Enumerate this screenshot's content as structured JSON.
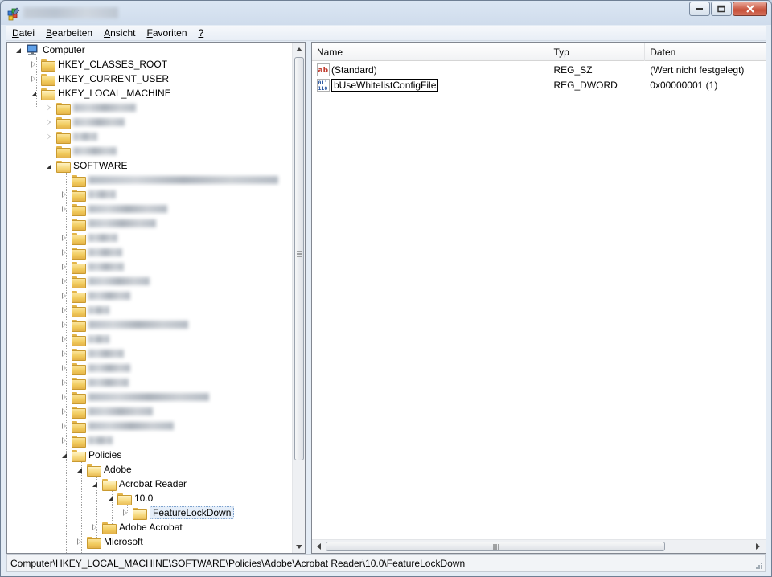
{
  "menu": [
    {
      "label": "Datei",
      "accel": "D",
      "rest": "atei"
    },
    {
      "label": "Bearbeiten",
      "accel": "B",
      "rest": "earbeiten"
    },
    {
      "label": "Ansicht",
      "accel": "A",
      "rest": "nsicht"
    },
    {
      "label": "Favoriten",
      "accel": "F",
      "rest": "avoriten"
    },
    {
      "label": "?",
      "accel": "?",
      "rest": ""
    }
  ],
  "tree": {
    "computer": "Computer",
    "hkcr": "HKEY_CLASSES_ROOT",
    "hkcu": "HKEY_CURRENT_USER",
    "hklm": "HKEY_LOCAL_MACHINE",
    "software": "SOFTWARE",
    "policies": "Policies",
    "adobe": "Adobe",
    "acrobat_reader": "Acrobat Reader",
    "version": "10.0",
    "featurelockdown": "FeatureLockDown",
    "adobe_acrobat": "Adobe Acrobat",
    "microsoft": "Microsoft"
  },
  "list": {
    "columns": {
      "name": "Name",
      "type": "Typ",
      "data": "Daten"
    },
    "rows": [
      {
        "name": "(Standard)",
        "type": "REG_SZ",
        "data": "(Wert nicht festgelegt)",
        "icon": "string-value-icon"
      },
      {
        "name": "bUseWhitelistConfigFile",
        "type": "REG_DWORD",
        "data": "0x00000001 (1)",
        "icon": "binary-value-icon"
      }
    ]
  },
  "status": {
    "path": "Computer\\HKEY_LOCAL_MACHINE\\SOFTWARE\\Policies\\Adobe\\Acrobat Reader\\10.0\\FeatureLockDown"
  },
  "colors": {
    "selection_border": "#7da2ce",
    "folder": "#f0c95a"
  }
}
